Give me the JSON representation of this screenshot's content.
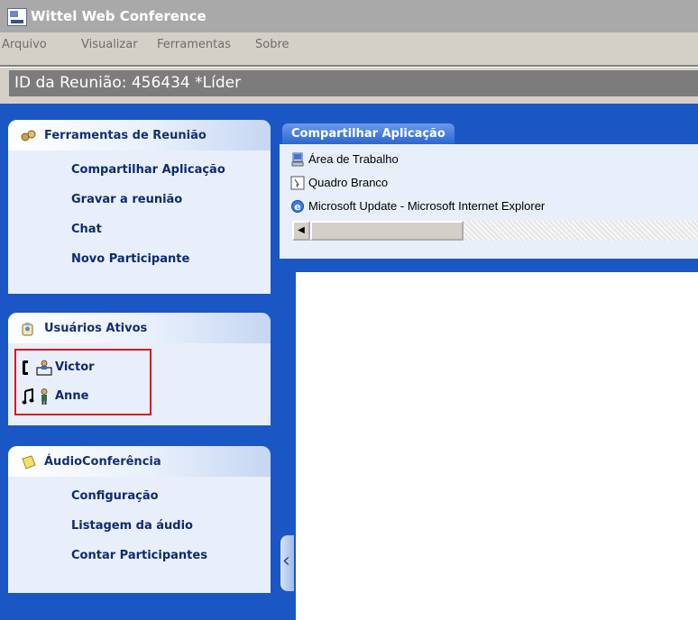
{
  "window": {
    "title": "Wittel Web Conference"
  },
  "menu": [
    "Arquivo",
    "Visualizar",
    "Ferramentas",
    "Sobre"
  ],
  "meeting": {
    "id_label": "ID da Reunião: 456434 *Líder"
  },
  "tools_panel": {
    "title": "Ferramentas de Reunião",
    "icon": "tools-icon",
    "items": [
      "Compartilhar Aplicação",
      "Gravar a reunião",
      "Chat",
      "Novo Participante"
    ]
  },
  "users_panel": {
    "title": "Usuários Ativos",
    "icon": "users-icon",
    "users": [
      {
        "name": "Victor",
        "status_icon": "phone-icon",
        "role_icon": "presenter-icon"
      },
      {
        "name": "Anne",
        "status_icon": "music-note-icon",
        "role_icon": "person-icon"
      }
    ]
  },
  "audio_panel": {
    "title": "ÁudioConferência",
    "icon": "note-icon",
    "items": [
      "Configuração",
      "Listagem da áudio",
      "Contar Participantes"
    ]
  },
  "share_app": {
    "title": "Compartilhar Aplicação",
    "items": [
      {
        "label": "Área de Trabalho",
        "icon": "desktop-icon"
      },
      {
        "label": "Quadro Branco",
        "icon": "whiteboard-icon"
      },
      {
        "label": "Microsoft Update - Microsoft Internet Explorer",
        "icon": "internet-explorer-icon"
      }
    ]
  },
  "colors": {
    "accent_blue": "#1b57c4",
    "panel_bg": "#e8effa",
    "highlight_red": "#e0131d"
  }
}
